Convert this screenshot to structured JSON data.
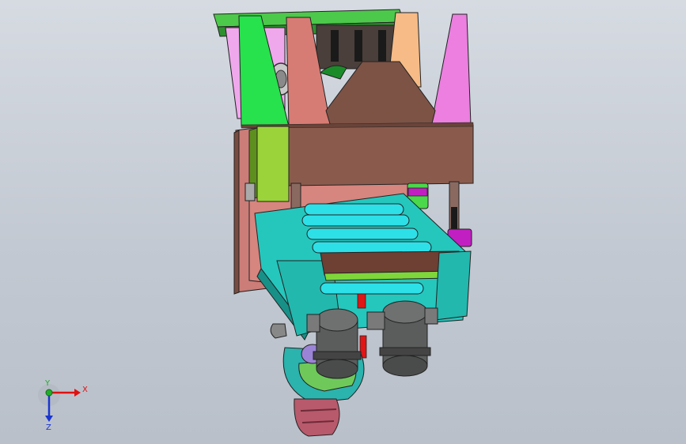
{
  "triad": {
    "x_label": "X",
    "y_label": "Y",
    "z_label": "Z",
    "x_color": "#e01010",
    "y_color": "#1fae2a",
    "z_color": "#1a35d0"
  },
  "colors": {
    "background": "#c8ced6",
    "top_frame": "#3fd04f",
    "brown_block": "#8a5a4c",
    "cyan_frame": "#28c6c0",
    "rollers": "#2de0e8",
    "rod_gray": "#6b6b6b",
    "magenta_spacer": "#c21fc2",
    "green_spacer": "#4cd84c",
    "salmon_plate": "#d38b86",
    "pink_plate": "#e88ae0",
    "dark_cylinder": "#5a5d5c",
    "red_bars": "#e01515"
  }
}
